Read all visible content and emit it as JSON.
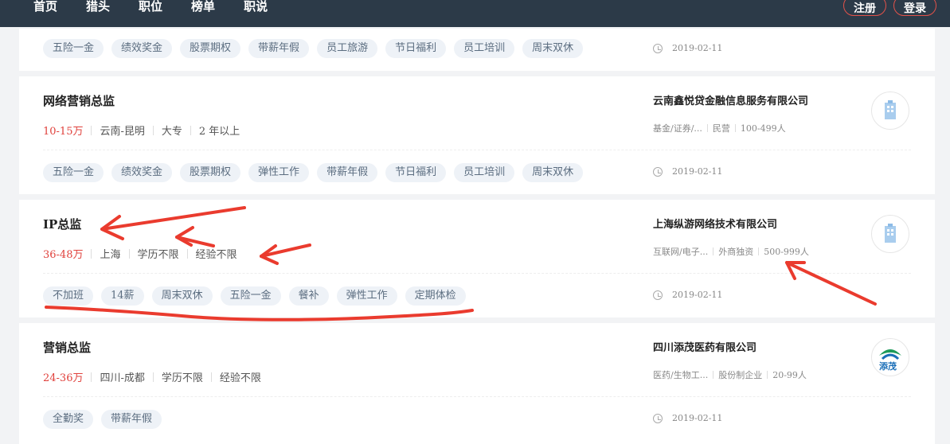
{
  "nav": {
    "items": [
      "首页",
      "猎头",
      "职位",
      "榜单",
      "职说"
    ],
    "register": "注册",
    "login": "登录"
  },
  "cards": [
    {
      "tags": [
        "五险一金",
        "绩效奖金",
        "股票期权",
        "带薪年假",
        "员工旅游",
        "节日福利",
        "员工培训",
        "周末双休"
      ],
      "date": "2019-02-11"
    },
    {
      "title": "网络营销总监",
      "salary": "10-15万",
      "location": "云南-昆明",
      "education": "大专",
      "experience": "2 年以上",
      "company": "云南鑫悦贷金融信息服务有限公司",
      "industry": "基金/证券/...",
      "company_type": "民营",
      "company_size": "100-499人",
      "tags": [
        "五险一金",
        "绩效奖金",
        "股票期权",
        "弹性工作",
        "带薪年假",
        "节日福利",
        "员工培训",
        "周末双休"
      ],
      "date": "2019-02-11"
    },
    {
      "title": "IP总监",
      "salary": "36-48万",
      "location": "上海",
      "education": "学历不限",
      "experience": "经验不限",
      "company": "上海纵游网络技术有限公司",
      "industry": "互联网/电子...",
      "company_type": "外商独资",
      "company_size": "500-999人",
      "tags": [
        "不加班",
        "14薪",
        "周末双休",
        "五险一金",
        "餐补",
        "弹性工作",
        "定期体检"
      ],
      "date": "2019-02-11"
    },
    {
      "title": "营销总监",
      "salary": "24-36万",
      "location": "四川-成都",
      "education": "学历不限",
      "experience": "经验不限",
      "company": "四川添茂医药有限公司",
      "industry": "医药/生物工...",
      "company_type": "股份制企业",
      "company_size": "20-99人",
      "logo_text": "添茂",
      "tags": [
        "全勤奖",
        "带薪年假"
      ],
      "date": "2019-02-11"
    }
  ],
  "colors": {
    "topbar": "#2c3a48",
    "salary": "#e0413c",
    "annotation": "#ea3b2e"
  }
}
